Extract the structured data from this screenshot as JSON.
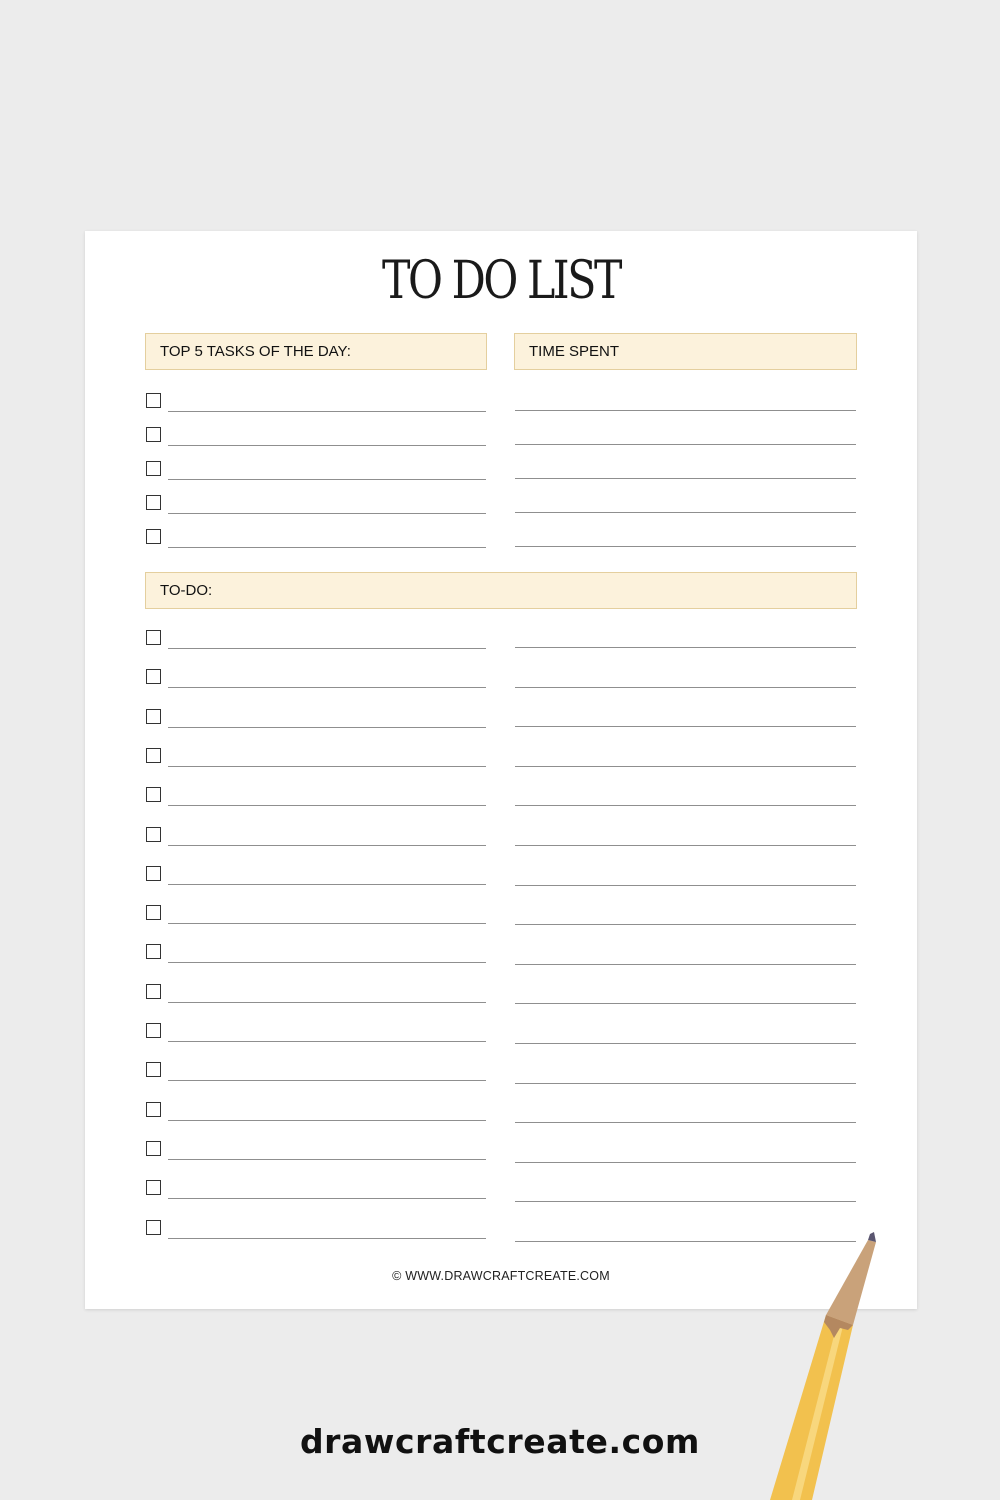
{
  "page": {
    "title": "TO DO LIST",
    "sections": {
      "top_tasks": {
        "header": "TOP 5 TASKS OF THE DAY:",
        "rows": 5
      },
      "time_spent": {
        "header": "TIME SPENT",
        "rows": 5
      },
      "todo": {
        "header": "TO-DO:",
        "rows": 16
      }
    },
    "footer": "© WWW.DRAWCRAFTCREATE.COM"
  },
  "brand": {
    "text": "drawcraftcreate.com"
  },
  "colors": {
    "background": "#ececec",
    "sheet": "#ffffff",
    "header_fill": "#fcf2dc",
    "header_border": "#e4cf9e",
    "line": "#8f8f8f",
    "pencil_body": "#f2c14e",
    "pencil_wood": "#c9a27a",
    "pencil_lead": "#5a5670"
  }
}
